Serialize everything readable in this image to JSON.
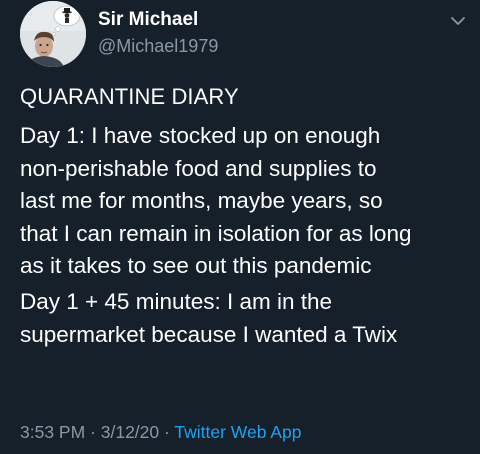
{
  "user": {
    "display_name": "Sir Michael",
    "handle": "@Michael1979"
  },
  "icons": {
    "avatar": "user-avatar",
    "menu": "chevron-down-icon"
  },
  "tweet": {
    "lines": {
      "title": "QUARANTINE DIARY",
      "p1": [
        "Day 1: I have stocked up on enough",
        "non-perishable food and supplies to",
        "last me for months, maybe years, so",
        "that I can remain in isolation for as long",
        "as it takes to see out this pandemic"
      ],
      "p2": [
        "Day 1 + 45 minutes: I am in the",
        "supermarket because I wanted a Twix"
      ]
    }
  },
  "meta": {
    "time": "3:53 PM",
    "separator": " · ",
    "date": "3/12/20",
    "source": "Twitter Web App"
  },
  "colors": {
    "background": "#15202b",
    "text": "#ffffff",
    "secondary": "#8899a6",
    "link": "#1da1f2"
  }
}
